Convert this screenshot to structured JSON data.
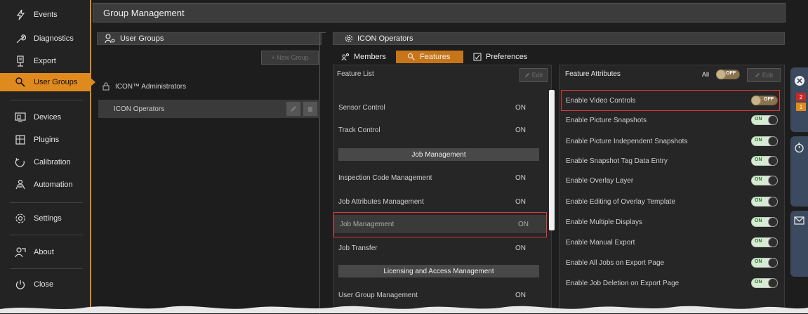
{
  "sidebar": {
    "items": [
      {
        "label": "Events",
        "icon": "lightning-icon"
      },
      {
        "label": "Diagnostics",
        "icon": "wrench-icon"
      },
      {
        "label": "Export",
        "icon": "export-icon"
      },
      {
        "label": "User Groups",
        "icon": "user-search-icon",
        "active": true
      },
      {
        "label": "Devices",
        "icon": "devices-icon"
      },
      {
        "label": "Plugins",
        "icon": "plugin-icon"
      },
      {
        "label": "Calibration",
        "icon": "calibration-icon"
      },
      {
        "label": "Automation",
        "icon": "automation-icon"
      },
      {
        "label": "Settings",
        "icon": "gear-icon"
      },
      {
        "label": "About",
        "icon": "about-icon"
      },
      {
        "label": "Close",
        "icon": "power-icon"
      }
    ]
  },
  "header": {
    "title": "Group Management"
  },
  "user_groups": {
    "title": "User Groups",
    "new_group_label": "+ New Group",
    "groups": [
      {
        "name": "ICON™ Administrators",
        "locked": true
      },
      {
        "name": "ICON Operators",
        "selected": true
      }
    ]
  },
  "operators_panel": {
    "title": "ICON Operators",
    "tabs": [
      {
        "label": "Members",
        "icon": "members-icon"
      },
      {
        "label": "Features",
        "icon": "features-icon",
        "active": true
      },
      {
        "label": "Preferences",
        "icon": "preferences-icon"
      }
    ]
  },
  "feature_list": {
    "title": "Feature List",
    "edit_label": "Edit",
    "rows": [
      {
        "type": "feature",
        "name": "Sensor Control",
        "value": "ON"
      },
      {
        "type": "feature",
        "name": "Track Control",
        "value": "ON"
      },
      {
        "type": "section",
        "name": "Job Management"
      },
      {
        "type": "feature",
        "name": "Inspection Code Management",
        "value": "ON"
      },
      {
        "type": "feature",
        "name": "Job Attributes Management",
        "value": "ON"
      },
      {
        "type": "feature",
        "name": "Job Management",
        "value": "ON",
        "highlighted": true
      },
      {
        "type": "feature",
        "name": "Job Transfer",
        "value": "ON"
      },
      {
        "type": "section",
        "name": "Licensing and Access Management"
      },
      {
        "type": "feature",
        "name": "User Group Management",
        "value": "ON"
      }
    ]
  },
  "feature_attributes": {
    "title": "Feature Attributes",
    "all_label": "All",
    "all_toggle": "OFF",
    "edit_label": "Edit",
    "rows": [
      {
        "name": "Enable Video Controls",
        "value": "OFF",
        "highlighted": true
      },
      {
        "name": "Enable Picture Snapshots",
        "value": "ON"
      },
      {
        "name": "Enable Picture Independent Snapshots",
        "value": "ON"
      },
      {
        "name": "Enable Snapshot Tag Data Entry",
        "value": "ON"
      },
      {
        "name": "Enable Overlay Layer",
        "value": "ON"
      },
      {
        "name": "Enable Editing of Overlay Template",
        "value": "ON"
      },
      {
        "name": "Enable Multiple Displays",
        "value": "ON"
      },
      {
        "name": "Enable Manual Export",
        "value": "ON"
      },
      {
        "name": "Enable All Jobs on Export Page",
        "value": "ON"
      },
      {
        "name": "Enable Job Deletion on Export Page",
        "value": "ON"
      }
    ]
  },
  "right_strip": {
    "badges": [
      "2",
      "1"
    ]
  },
  "colors": {
    "accent": "#e08a1e",
    "tab_active": "#c8751a",
    "highlight": "#e23a3a",
    "toggle_on_text": "#2c7a2c"
  }
}
